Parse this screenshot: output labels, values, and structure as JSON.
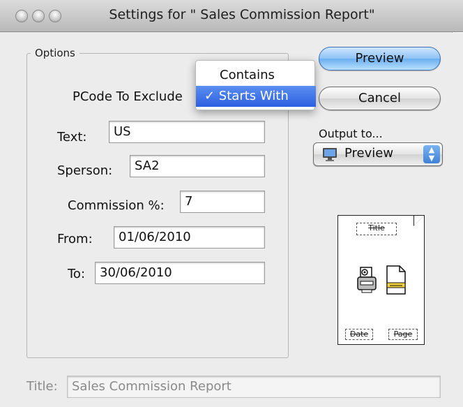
{
  "window": {
    "title": "Settings for \" Sales Commission Report\""
  },
  "options": {
    "group_label": "Options",
    "pcode_label": "PCode To Exclude",
    "text_label": "Text:",
    "text_value": "US",
    "sperson_label": "Sperson:",
    "sperson_value": "SA2",
    "commission_label": "Commission %:",
    "commission_value": "7",
    "from_label": "From:",
    "from_value": "01/06/2010",
    "to_label": "To:",
    "to_value": "30/06/2010"
  },
  "dropdown_menu": {
    "items": [
      {
        "label": "Contains",
        "selected": false
      },
      {
        "label": "✓ Starts With",
        "selected": true
      }
    ]
  },
  "buttons": {
    "preview": "Preview",
    "cancel": "Cancel"
  },
  "output": {
    "label": "Output to...",
    "selected": "Preview",
    "icon": "monitor-icon"
  },
  "page_preview": {
    "title": "Title",
    "date": "Date",
    "page": "Page"
  },
  "footer": {
    "title_label": "Title:",
    "title_placeholder": "Sales Commission Report"
  },
  "colors": {
    "default_button": "#6aaef0",
    "menu_selection": "#2c5fe0"
  }
}
